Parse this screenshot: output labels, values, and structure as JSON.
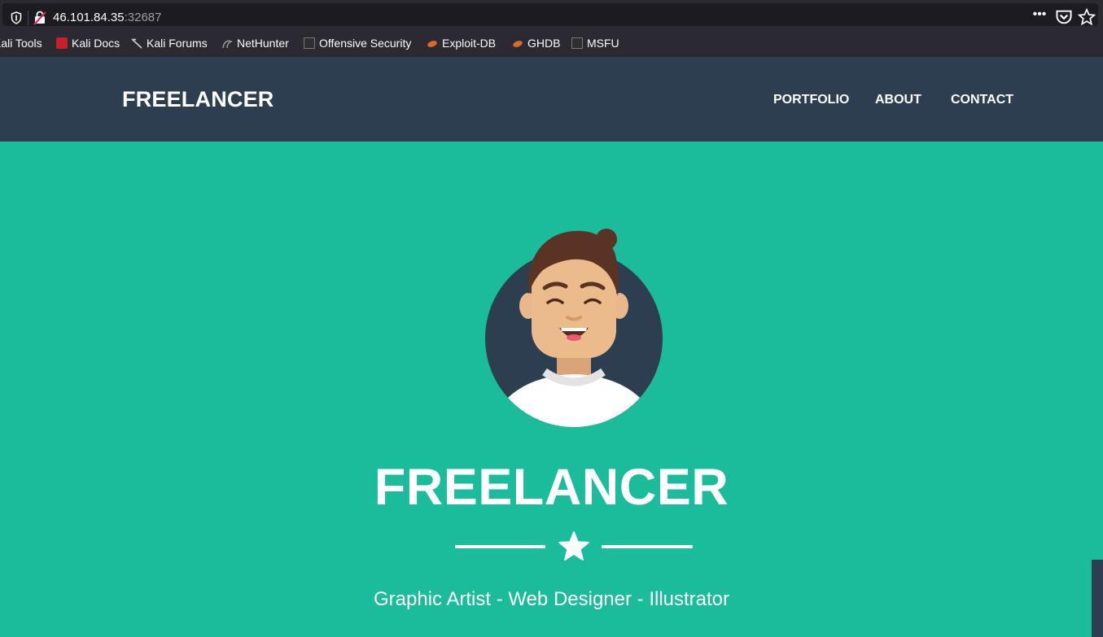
{
  "browser": {
    "url_host": "46.101.84.35",
    "url_port": ":32687",
    "actions": [
      "more-icon",
      "pocket-icon",
      "bookmark-star-icon"
    ],
    "bookmarks": [
      {
        "label": "Kali Tools",
        "icon": "kali-tools-icon"
      },
      {
        "label": "Kali Docs",
        "icon": "kali-docs-icon"
      },
      {
        "label": "Kali Forums",
        "icon": "kali-forums-icon"
      },
      {
        "label": "NetHunter",
        "icon": "nethunter-icon"
      },
      {
        "label": "Offensive Security",
        "icon": "offensive-security-icon"
      },
      {
        "label": "Exploit-DB",
        "icon": "exploit-db-icon"
      },
      {
        "label": "GHDB",
        "icon": "ghdb-icon"
      },
      {
        "label": "MSFU",
        "icon": "msfu-icon"
      }
    ]
  },
  "site": {
    "brand": "FREELANCER",
    "nav": [
      "PORTFOLIO",
      "ABOUT",
      "CONTACT"
    ],
    "hero_title": "FREELANCER",
    "hero_subtitle": "Graphic Artist - Web Designer - Illustrator",
    "colors": {
      "primary": "#1abc9c",
      "nav_bg": "#2c3e50",
      "text": "#ffffff"
    }
  }
}
